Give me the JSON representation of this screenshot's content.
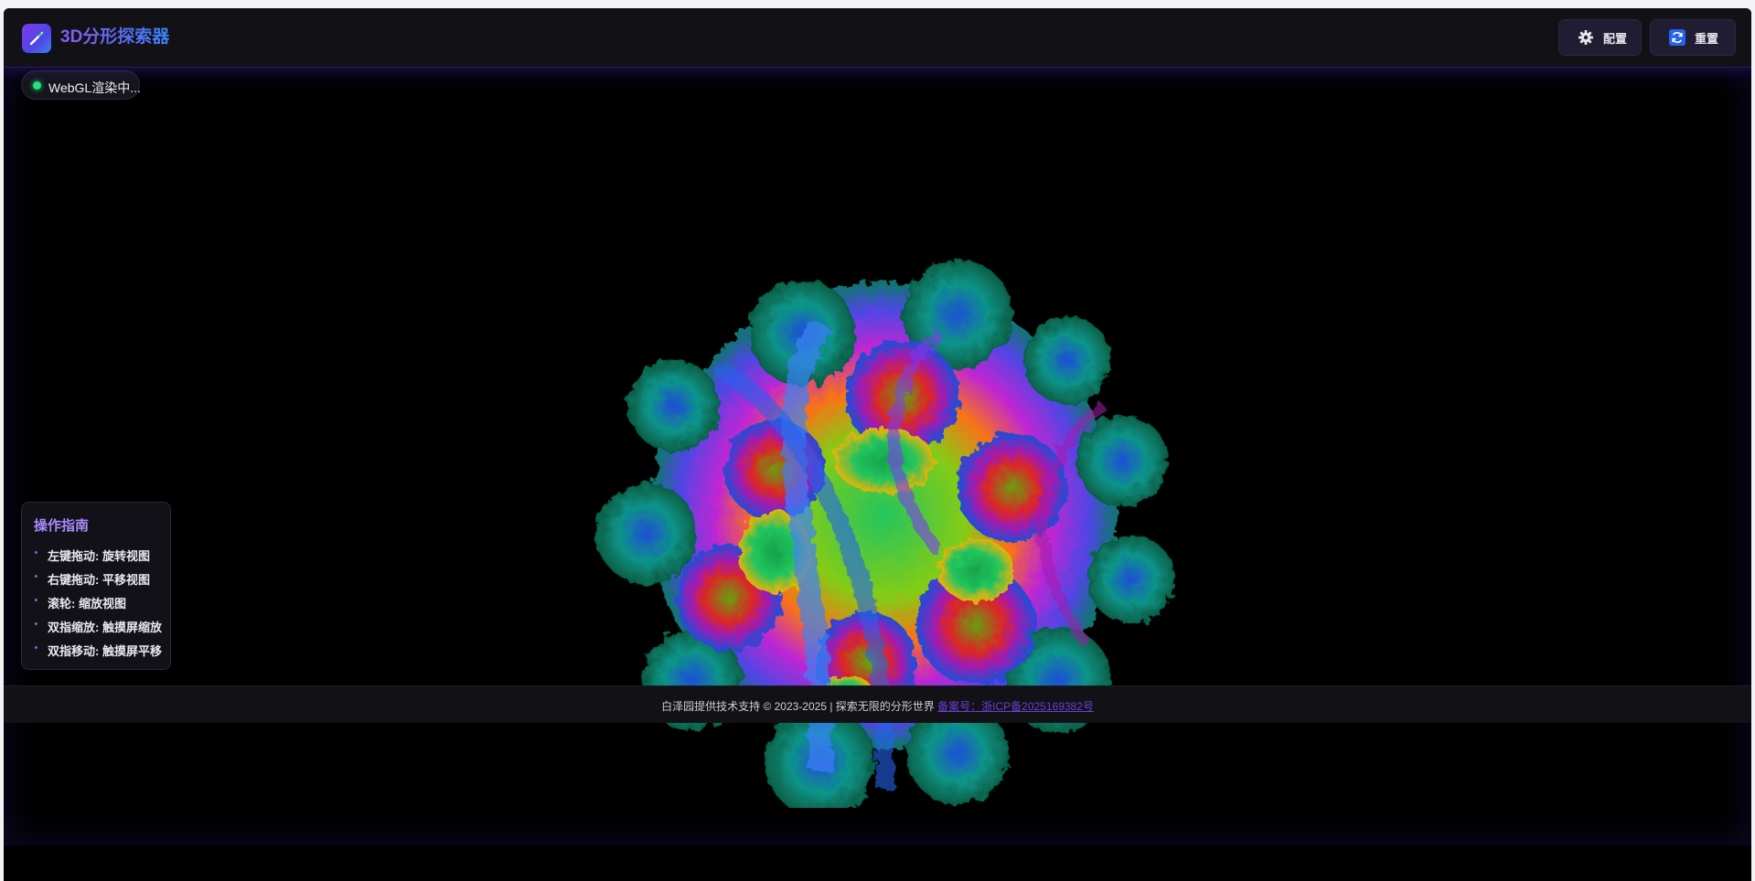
{
  "header": {
    "title": "3D分形探索器",
    "logo_icon": "wand-icon",
    "buttons": [
      {
        "label": "配置",
        "icon": "gear-icon"
      },
      {
        "label": "重置",
        "icon": "refresh-icon"
      }
    ]
  },
  "status": {
    "text": "WebGL渲染中...",
    "dot_color": "#22e07a"
  },
  "guide": {
    "title": "操作指南",
    "items": [
      "左键拖动: 旋转视图",
      "右键拖动: 平移视图",
      "滚轮: 缩放视图",
      "双指缩放: 触摸屏缩放",
      "双指移动: 触摸屏平移"
    ]
  },
  "footer": {
    "text": "白泽园提供技术支持 © 2023-2025 | 探索无限的分形世界",
    "link_text": "备案号：浙ICP备2025169382号"
  },
  "colors": {
    "accent_purple": "#8b5cf6",
    "accent_blue": "#3b82f6",
    "panel_bg": "#121116",
    "canvas_bg": "#000000"
  }
}
